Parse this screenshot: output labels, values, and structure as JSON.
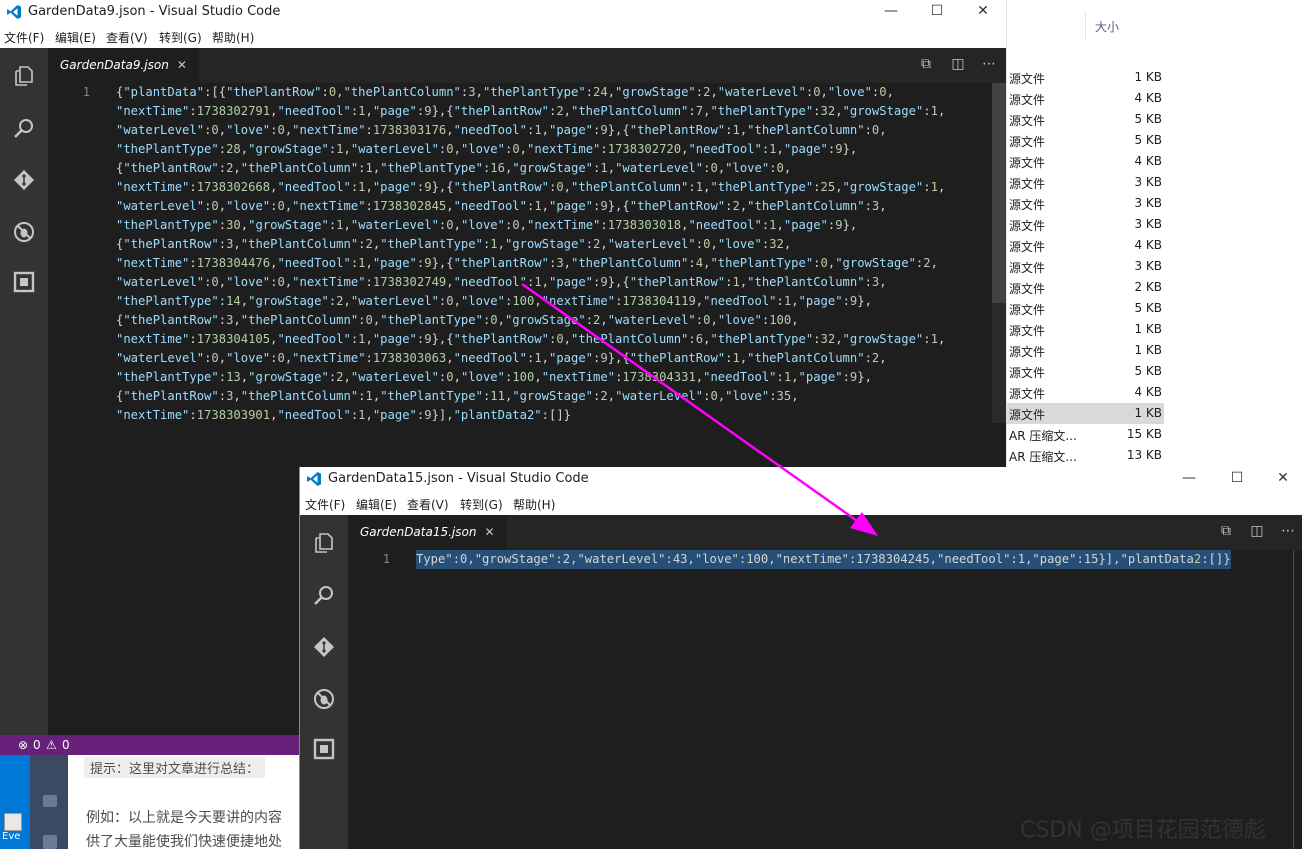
{
  "explorer": {
    "size_header": "大小",
    "rows": [
      {
        "name": "源文件",
        "size": "1 KB"
      },
      {
        "name": "源文件",
        "size": "4 KB"
      },
      {
        "name": "源文件",
        "size": "5 KB"
      },
      {
        "name": "源文件",
        "size": "5 KB"
      },
      {
        "name": "源文件",
        "size": "4 KB"
      },
      {
        "name": "源文件",
        "size": "3 KB"
      },
      {
        "name": "源文件",
        "size": "3 KB"
      },
      {
        "name": "源文件",
        "size": "3 KB"
      },
      {
        "name": "源文件",
        "size": "4 KB"
      },
      {
        "name": "源文件",
        "size": "3 KB"
      },
      {
        "name": "源文件",
        "size": "2 KB"
      },
      {
        "name": "源文件",
        "size": "5 KB"
      },
      {
        "name": "源文件",
        "size": "1 KB"
      },
      {
        "name": "源文件",
        "size": "1 KB"
      },
      {
        "name": "源文件",
        "size": "5 KB"
      },
      {
        "name": "源文件",
        "size": "4 KB"
      },
      {
        "name": "源文件",
        "size": "1 KB",
        "selected": true
      },
      {
        "name": "AR 压缩文...",
        "size": "15 KB"
      },
      {
        "name": "AR 压缩文...",
        "size": "13 KB"
      }
    ]
  },
  "blog": {
    "hint": "提示：这里对文章进行总结：",
    "para1": "例如：以上就是今天要讲的内容",
    "para2": "供了大量能使我们快速便捷地处",
    "desktop_label": "Eve"
  },
  "window1": {
    "title": "GardenData9.json - Visual Studio Code",
    "menu": [
      "文件(F)",
      "编辑(E)",
      "查看(V)",
      "转到(G)",
      "帮助(H)"
    ],
    "tab_label": "GardenData9.json",
    "line_number": "1",
    "code_lines": [
      "{\"plantData\":[{\"thePlantRow\":0,\"thePlantColumn\":3,\"thePlantType\":24,\"growStage\":2,\"waterLevel\":0,\"love\":0,",
      "\"nextTime\":1738302791,\"needTool\":1,\"page\":9},{\"thePlantRow\":2,\"thePlantColumn\":7,\"thePlantType\":32,\"growStage\":1,",
      "\"waterLevel\":0,\"love\":0,\"nextTime\":1738303176,\"needTool\":1,\"page\":9},{\"thePlantRow\":1,\"thePlantColumn\":0,",
      "\"thePlantType\":28,\"growStage\":1,\"waterLevel\":0,\"love\":0,\"nextTime\":1738302720,\"needTool\":1,\"page\":9},",
      "{\"thePlantRow\":2,\"thePlantColumn\":1,\"thePlantType\":16,\"growStage\":1,\"waterLevel\":0,\"love\":0,",
      "\"nextTime\":1738302668,\"needTool\":1,\"page\":9},{\"thePlantRow\":0,\"thePlantColumn\":1,\"thePlantType\":25,\"growStage\":1,",
      "\"waterLevel\":0,\"love\":0,\"nextTime\":1738302845,\"needTool\":1,\"page\":9},{\"thePlantRow\":2,\"thePlantColumn\":3,",
      "\"thePlantType\":30,\"growStage\":1,\"waterLevel\":0,\"love\":0,\"nextTime\":1738303018,\"needTool\":1,\"page\":9},",
      "{\"thePlantRow\":3,\"thePlantColumn\":2,\"thePlantType\":1,\"growStage\":2,\"waterLevel\":0,\"love\":32,",
      "\"nextTime\":1738304476,\"needTool\":1,\"page\":9},{\"thePlantRow\":3,\"thePlantColumn\":4,\"thePlantType\":0,\"growStage\":2,",
      "\"waterLevel\":0,\"love\":0,\"nextTime\":1738302749,\"needTool\":1,\"page\":9},{\"thePlantRow\":1,\"thePlantColumn\":3,",
      "\"thePlantType\":14,\"growStage\":2,\"waterLevel\":0,\"love\":100,\"nextTime\":1738304119,\"needTool\":1,\"page\":9},",
      "{\"thePlantRow\":3,\"thePlantColumn\":0,\"thePlantType\":0,\"growStage\":2,\"waterLevel\":0,\"love\":100,",
      "\"nextTime\":1738304105,\"needTool\":1,\"page\":9},{\"thePlantRow\":0,\"thePlantColumn\":6,\"thePlantType\":32,\"growStage\":1,",
      "\"waterLevel\":0,\"love\":0,\"nextTime\":1738303063,\"needTool\":1,\"page\":9},{\"thePlantRow\":1,\"thePlantColumn\":2,",
      "\"thePlantType\":13,\"growStage\":2,\"waterLevel\":0,\"love\":100,\"nextTime\":1738304331,\"needTool\":1,\"page\":9},",
      "{\"thePlantRow\":3,\"thePlantColumn\":1,\"thePlantType\":11,\"growStage\":2,\"waterLevel\":0,\"love\":35,",
      "\"nextTime\":1738303901,\"needTool\":1,\"page\":9}],\"plantData2\":[]}"
    ],
    "status_errors": "0",
    "status_warnings": "0"
  },
  "window2": {
    "title": "GardenData15.json - Visual Studio Code",
    "menu": [
      "文件(F)",
      "编辑(E)",
      "查看(V)",
      "转到(G)",
      "帮助(H)"
    ],
    "tab_label": "GardenData15.json",
    "line_number": "1",
    "code_line": "Type\":0,\"growStage\":2,\"waterLevel\":43,\"love\":100,\"nextTime\":1738304245,\"needTool\":1,\"page\":15}],\"plantData2\":[]}"
  },
  "watermark": "CSDN @项目花园范德彪",
  "colors": {
    "arrow": "#ff00ff",
    "editor_bg": "#1e1e1e",
    "activity_bar": "#333333",
    "status_bar": "#68217a",
    "json_key": "#9cdcfe",
    "json_number": "#b5cea8",
    "selection": "#264f78"
  }
}
